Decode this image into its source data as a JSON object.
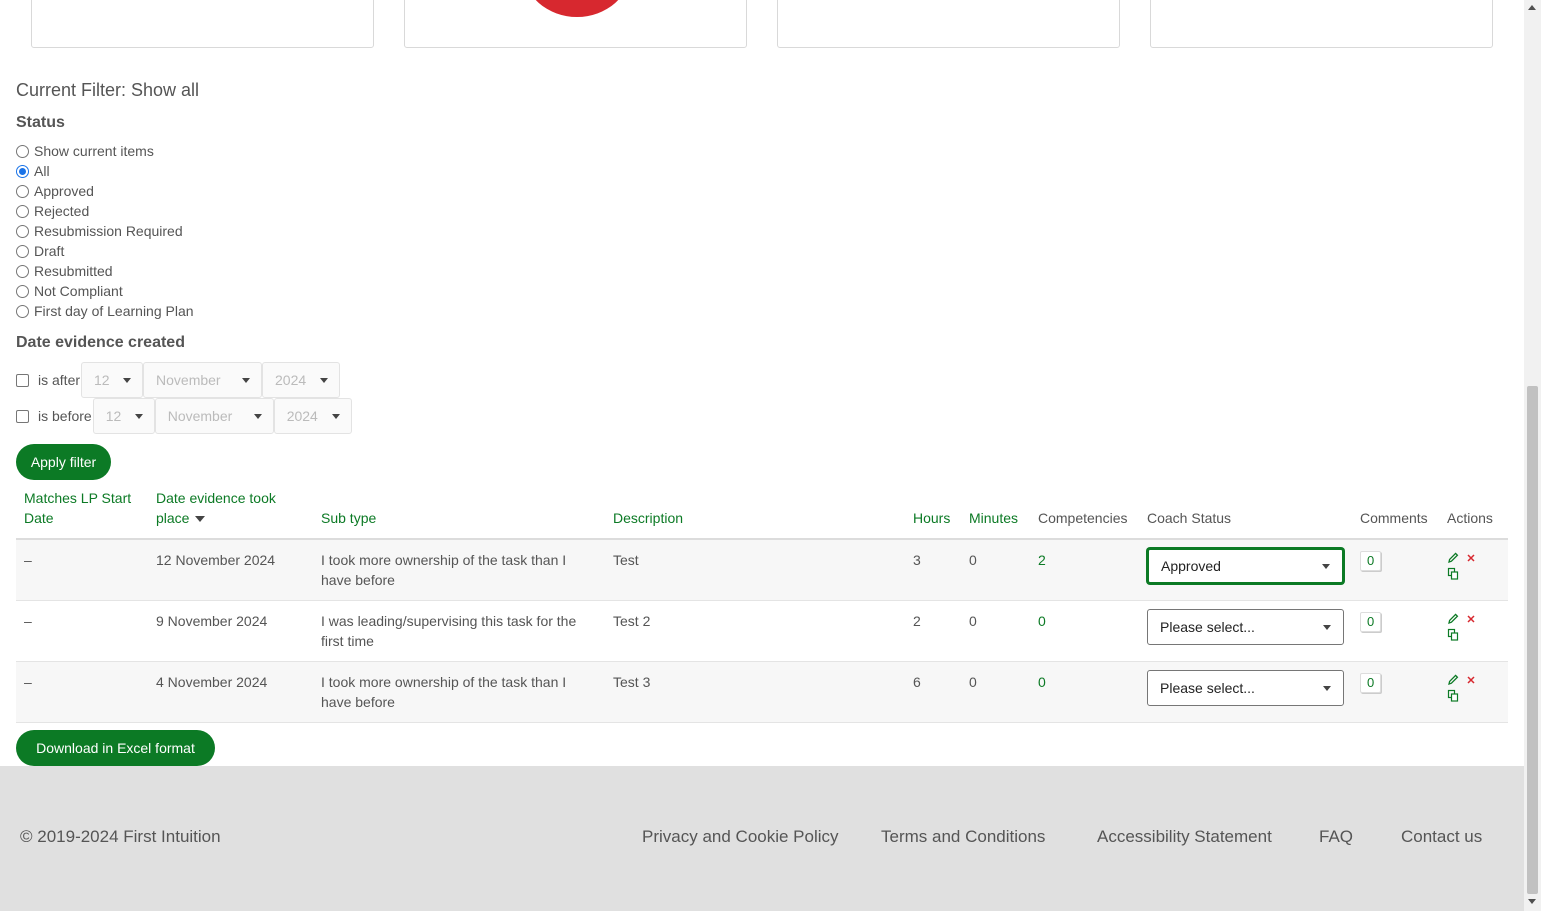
{
  "filter": {
    "current_label": "Current Filter: Show all",
    "status_heading": "Status",
    "status_options": [
      {
        "label": "Show current items",
        "checked": false
      },
      {
        "label": "All",
        "checked": true
      },
      {
        "label": "Approved",
        "checked": false
      },
      {
        "label": "Rejected",
        "checked": false
      },
      {
        "label": "Resubmission Required",
        "checked": false
      },
      {
        "label": "Draft",
        "checked": false
      },
      {
        "label": "Resubmitted",
        "checked": false
      },
      {
        "label": "Not Compliant",
        "checked": false
      },
      {
        "label": "First day of Learning Plan",
        "checked": false
      }
    ],
    "date_heading": "Date evidence created",
    "after": {
      "label": "is after",
      "day": "12",
      "month": "November",
      "year": "2024"
    },
    "before": {
      "label": "is before",
      "day": "12",
      "month": "November",
      "year": "2024"
    },
    "apply_label": "Apply filter"
  },
  "table": {
    "headers": {
      "matches": "Matches LP Start Date",
      "date": "Date evidence took place",
      "subtype": "Sub type",
      "description": "Description",
      "hours": "Hours",
      "minutes": "Minutes",
      "competencies": "Competencies",
      "coach_status": "Coach Status",
      "comments": "Comments",
      "actions": "Actions"
    },
    "rows": [
      {
        "matches": "–",
        "date": "12 November 2024",
        "subtype": "I took more ownership of the task than I have before",
        "description": "Test",
        "hours": "3",
        "minutes": "0",
        "competencies": "2",
        "coach_status": "Approved",
        "comments": "0"
      },
      {
        "matches": "–",
        "date": "9 November 2024",
        "subtype": "I was leading/supervising this task for the first time",
        "description": "Test 2",
        "hours": "2",
        "minutes": "0",
        "competencies": "0",
        "coach_status": "Please select...",
        "comments": "0"
      },
      {
        "matches": "–",
        "date": "4 November 2024",
        "subtype": "I took more ownership of the task than I have before",
        "description": "Test 3",
        "hours": "6",
        "minutes": "0",
        "competencies": "0",
        "coach_status": "Please select...",
        "comments": "0"
      }
    ]
  },
  "download_label": "Download in Excel format",
  "footer": {
    "copyright": "© 2019-2024 First Intuition",
    "links": [
      "Privacy and Cookie Policy",
      "Terms and Conditions",
      "Accessibility Statement",
      "FAQ",
      "Contact us"
    ]
  },
  "colors": {
    "brand_green": "#0c7a25",
    "alert_red": "#d7282f",
    "footer_bg": "#e0e0e0"
  },
  "icons": {
    "edit": "pencil-icon",
    "delete": "close-icon",
    "copy": "copy-icon"
  }
}
